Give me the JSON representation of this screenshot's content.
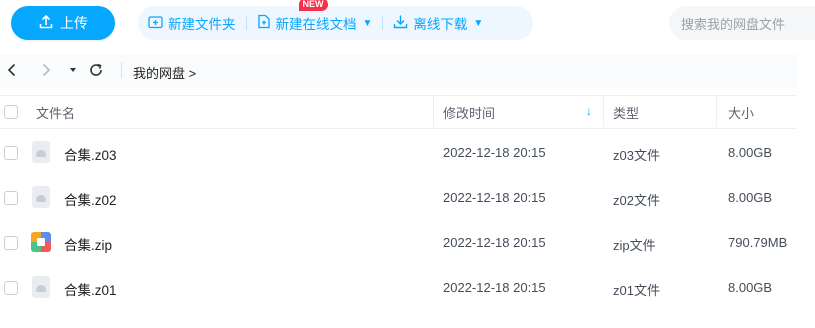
{
  "toolbar": {
    "upload_label": "上传",
    "new_folder_label": "新建文件夹",
    "new_online_doc_label": "新建在线文档",
    "new_badge": "NEW",
    "offline_download_label": "离线下载",
    "search_placeholder": "搜索我的网盘文件",
    "accent_color": "#06a7ff",
    "badge_color": "#f6304a"
  },
  "nav": {
    "back_icon": "chevron-left-icon",
    "forward_icon": "chevron-right-icon",
    "dropdown_icon": "caret-down-icon",
    "refresh_icon": "refresh-icon",
    "breadcrumb": "我的网盘 >"
  },
  "table": {
    "headers": {
      "name": "文件名",
      "modified": "修改时间",
      "sort_indicator": "↓",
      "type": "类型",
      "size": "大小"
    },
    "rows": [
      {
        "name": "合集.z03",
        "modified": "2022-12-18 20:15",
        "type": "z03文件",
        "size": "8.00GB",
        "icon": "file-icon"
      },
      {
        "name": "合集.z02",
        "modified": "2022-12-18 20:15",
        "type": "z02文件",
        "size": "8.00GB",
        "icon": "file-icon"
      },
      {
        "name": "合集.zip",
        "modified": "2022-12-18 20:15",
        "type": "zip文件",
        "size": "790.79MB",
        "icon": "zip-icon"
      },
      {
        "name": "合集.z01",
        "modified": "2022-12-18 20:15",
        "type": "z01文件",
        "size": "8.00GB",
        "icon": "file-icon"
      }
    ]
  }
}
